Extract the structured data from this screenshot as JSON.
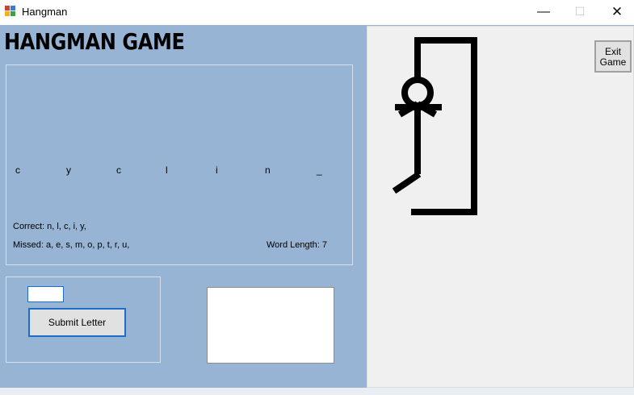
{
  "window": {
    "title": "Hangman",
    "min_glyph": "—",
    "max_glyph": "☐",
    "close_glyph": "✕"
  },
  "game": {
    "heading": "HANGMAN GAME",
    "word_letters": [
      "c",
      "y",
      "c",
      "l",
      "i",
      "n",
      "_"
    ],
    "correct_text": "Correct: n, l, c, i, y,",
    "missed_text": "Missed: a, e, s, m, o, p, t, r, u,",
    "word_length_text": "Word Length: 7"
  },
  "input": {
    "value": "",
    "submit_label": "Submit Letter"
  },
  "output_box_text": "",
  "exit": {
    "line1": "Exit",
    "line2": "Game"
  },
  "hangman_state": {
    "missed_count": 9,
    "drawn_parts": [
      "gallows",
      "head",
      "arms",
      "body",
      "left-leg"
    ]
  },
  "colors": {
    "client_bg": "#98b4d4",
    "panel_bg": "#f0f0f0",
    "accent_border": "#1e6ec8"
  }
}
